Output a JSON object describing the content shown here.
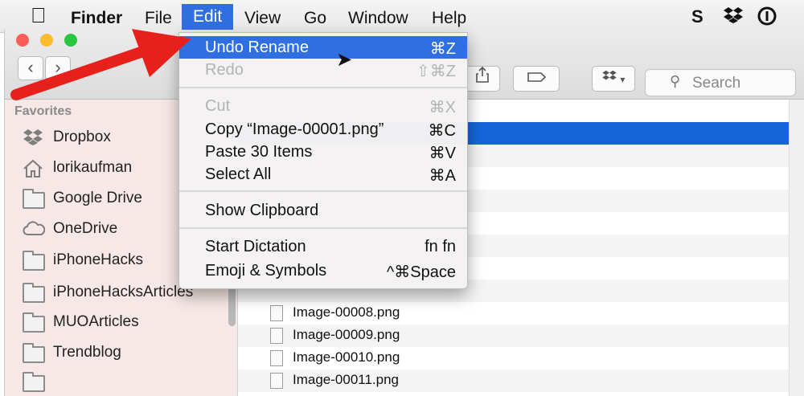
{
  "menubar": {
    "apple_icon": "apple-icon",
    "items": [
      {
        "label": "Finder"
      },
      {
        "label": "File"
      },
      {
        "label": "Edit"
      },
      {
        "label": "View"
      },
      {
        "label": "Go"
      },
      {
        "label": "Window"
      },
      {
        "label": "Help"
      }
    ],
    "status_icons": [
      "skype-s-icon",
      "dropbox-icon",
      "1password-icon"
    ]
  },
  "toolbar": {
    "back_glyph": "‹",
    "forward_glyph": "›",
    "search_placeholder": "Search"
  },
  "sidebar": {
    "section_title": "Favorites",
    "items": [
      {
        "label": "Dropbox",
        "icon": "dropbox-icon"
      },
      {
        "label": "lorikaufman",
        "icon": "home-icon"
      },
      {
        "label": "Google Drive",
        "icon": "folder-icon"
      },
      {
        "label": "OneDrive",
        "icon": "cloud-icon"
      },
      {
        "label": "iPhoneHacks",
        "icon": "folder-icon"
      },
      {
        "label": "iPhoneHacksArticles",
        "icon": "folder-icon"
      },
      {
        "label": "MUOArticles",
        "icon": "folder-icon"
      },
      {
        "label": "Trendblog",
        "icon": "folder-icon"
      }
    ]
  },
  "files": [
    {
      "name": "Image-00008.png"
    },
    {
      "name": "Image-00009.png"
    },
    {
      "name": "Image-00010.png"
    },
    {
      "name": "Image-00011.png"
    }
  ],
  "edit_menu": {
    "items": [
      {
        "label": "Undo Rename",
        "shortcut": "⌘Z",
        "state": "highlighted"
      },
      {
        "label": "Redo",
        "shortcut": "⇧⌘Z",
        "state": "disabled"
      },
      {
        "label": "Cut",
        "shortcut": "⌘X",
        "state": "disabled"
      },
      {
        "label": "Copy “Image-00001.png”",
        "shortcut": "⌘C",
        "state": "enabled"
      },
      {
        "label": "Paste 30 Items",
        "shortcut": "⌘V",
        "state": "enabled"
      },
      {
        "label": "Select All",
        "shortcut": "⌘A",
        "state": "enabled"
      },
      {
        "label": "Show Clipboard",
        "shortcut": "",
        "state": "enabled"
      },
      {
        "label": "Start Dictation",
        "shortcut": "fn fn",
        "state": "enabled"
      },
      {
        "label": "Emoji & Symbols",
        "shortcut": "^⌘Space",
        "state": "enabled"
      }
    ]
  },
  "colors": {
    "menu_highlight": "#2f6fe0",
    "selection": "#1565d8",
    "arrow": "#e8201c"
  }
}
